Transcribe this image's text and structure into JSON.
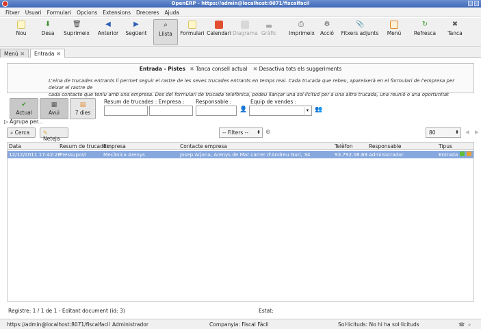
{
  "window": {
    "title": "OpenERP - https://admin@localhost:8071/fiscalfacil"
  },
  "menu": [
    "Fitxer",
    "Usuari",
    "Formulari",
    "Opcions",
    "Extensions",
    "Dreceres",
    "Ajuda"
  ],
  "toolbar": {
    "new": "Nou",
    "save": "Desa",
    "delete": "Suprimeix",
    "previous": "Anterior",
    "next": "Següent",
    "list": "Llista",
    "form": "Formulari",
    "calendar": "Calendari",
    "diagram": "Diagrama",
    "graph": "Gràfic",
    "print": "Imprimeix",
    "action": "Acció",
    "attachments": "Fitxers adjunts",
    "menu": "Menú",
    "refresh": "Refresca",
    "close": "Tanca"
  },
  "tabs": [
    {
      "label": "Menú"
    },
    {
      "label": "Entrada"
    }
  ],
  "info": {
    "title": "Entrada - Pistes",
    "hide_tip": "Tanca consell actual",
    "disable_all": "Desactiva tots els suggeriments",
    "message_line1": "L'eina de trucades entrants li permet seguir el rastre de les seves trucades entrants en temps real. Cada trucada que rebeu, apareixerà en el formulari de l'empresa per deixar el rastre de",
    "message_line2": "cada contacte que teniu amb una empresa. Des del formulari de trucada telefònica, podeu llançar una sol·licitud per a una altra trucada, una reunió o una oportunitat"
  },
  "filters": {
    "actual": "Actual",
    "today": "Avui",
    "seven_days": "7 dies",
    "summary_company_label": "Resum de trucades : Empresa :",
    "responsible_label": "Responsable :",
    "sales_team_label": "Equip de vendes :",
    "group_by": "Agrupa per...",
    "search": "Cerca",
    "clear": "Neteja",
    "filters_combo": "-- Filters --",
    "limit": "80"
  },
  "table": {
    "columns": [
      "Data",
      "Resum de trucades",
      "Empresa",
      "Contacte empresa",
      "Telèfon",
      "Responsable",
      "Tipus"
    ],
    "rows": [
      [
        "12/12/2011 17:42:26",
        "Pressupost",
        "Mecànica Arenys",
        "Josep Arjona,  Arenys de Mar carrer d'Andreu Guri, 34",
        "93.792.08.69",
        "Administrador",
        "Entrada"
      ]
    ]
  },
  "record": {
    "text": "Registre: 1 / 1 de 1 - Editant document (id: 3)",
    "state_label": "Estat:"
  },
  "status": {
    "url": "https://admin@localhost:8071/fiscalfacil",
    "user": "Administrador",
    "company": "Companyia: Fiscal Fàcil",
    "requests": "Sol·licituds:  No hi ha sol·licituds"
  },
  "colors": {
    "selected_row": "#86a8de",
    "titlebar": "#3f68b5"
  }
}
